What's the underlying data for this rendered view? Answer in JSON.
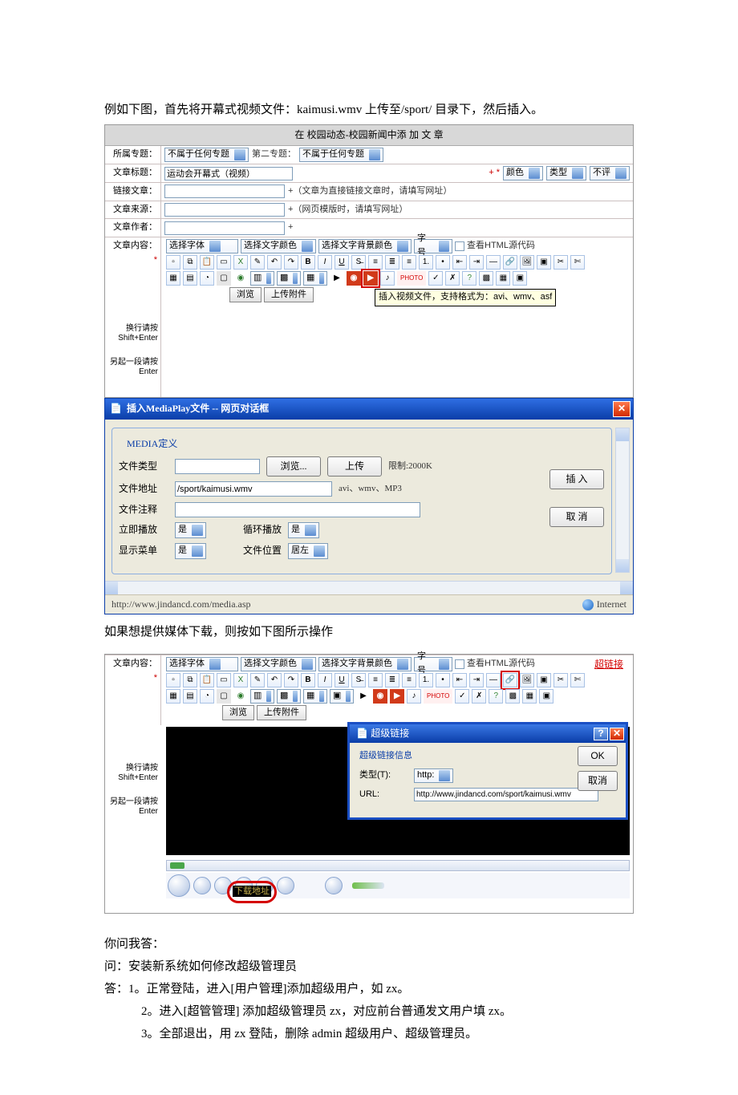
{
  "intro_text": "例如下图，首先将开幕式视频文件：kaimusi.wmv  上传至/sport/    目录下，然后插入。",
  "form": {
    "header": "在  校园动态-校园新闻中添  加  文  章",
    "topic_label": "所属专题：",
    "topic_value": "不属于任何专题",
    "topic2_label": "第二专题：",
    "topic2_value": "不属于任何专题",
    "title_label": "文章标题：",
    "title_value": "运动会开幕式（视频）",
    "star": "+ *",
    "color_label": "颜色",
    "type_label": "类型",
    "review_label": "不评",
    "link_label": "链接文章：",
    "link_hint": "+（文章为直接链接文章时，请填写网址）",
    "source_label": "文章来源：",
    "source_hint": "+（网页模版时，请填写网址）",
    "author_label": "文章作者：",
    "author_hint": "+",
    "content_label": "文章内容：",
    "font_select": "选择字体",
    "text_color": "选择文字颜色",
    "bg_color": "选择文字背景颜色",
    "font_size": "字号",
    "view_source": "查看HTML源代码",
    "letters": {
      "B": "B",
      "I": "I",
      "U": "U"
    },
    "photo": "PHOTO",
    "browse": "浏览",
    "upload_attach": "上传附件",
    "tooltip_insert_video": "插入视频文件，支持格式为：avi、wmv、asf",
    "note1a": "换行请按",
    "note1b": "Shift+Enter",
    "note2a": "另起一段请按",
    "note2b": "Enter"
  },
  "dialog": {
    "title": "插入MediaPlay文件  --  网页对话框",
    "legend": "MEDIA定义",
    "file_type_label": "文件类型",
    "browse_btn": "浏览...",
    "upload_btn": "上传",
    "limit": "限制:2000K",
    "file_addr_label": "文件地址",
    "file_addr_value": "/sport/kaimusi.wmv",
    "formats": "avi、wmv、MP3",
    "file_note_label": "文件注释",
    "autoplay_label": "立即播放",
    "loop_label": "循环播放",
    "showmenu_label": "显示菜单",
    "position_label": "文件位置",
    "yes": "是",
    "pos_left": "居左",
    "insert_btn": "插  入",
    "cancel_btn": "取  消",
    "status_url": "http://www.jindancd.com/media.asp",
    "status_zone": "Internet"
  },
  "mid_text": "如果想提供媒体下载，则按如下图所示操作",
  "shot2": {
    "content_label": "文章内容：",
    "font_select": "选择字体",
    "text_color": "选择文字颜色",
    "bg_color": "选择文字背景颜色",
    "font_size": "字号",
    "view_source": "查看HTML源代码",
    "super_link_annot": "超链接",
    "browse": "浏览",
    "upload_attach": "上传附件",
    "note1a": "换行请按",
    "note1b": "Shift+Enter",
    "note2a": "另起一段请按",
    "note2b": "Enter",
    "download_label": "下载地址",
    "hl_title": "超级链接",
    "hl_fs_title": "超级链接信息",
    "hl_type_label": "类型(T):",
    "hl_type_value": "http:",
    "hl_url_label": "URL:",
    "hl_url_value": "http://www.jindancd.com/sport/kaimusi.wmv",
    "ok": "OK",
    "cancel": "取消"
  },
  "qa": {
    "heading": "你问我答：",
    "q": "问：安装新系统如何修改超级管理员",
    "a1": "答：1。正常登陆，进入[用户管理]添加超级用户，如 zx。",
    "a2": "2。进入[超管管理]  添加超级管理员 zx，对应前台普通发文用户填 zx。",
    "a3": "3。全部退出，用 zx 登陆，删除 admin 超级用户、超级管理员。"
  }
}
